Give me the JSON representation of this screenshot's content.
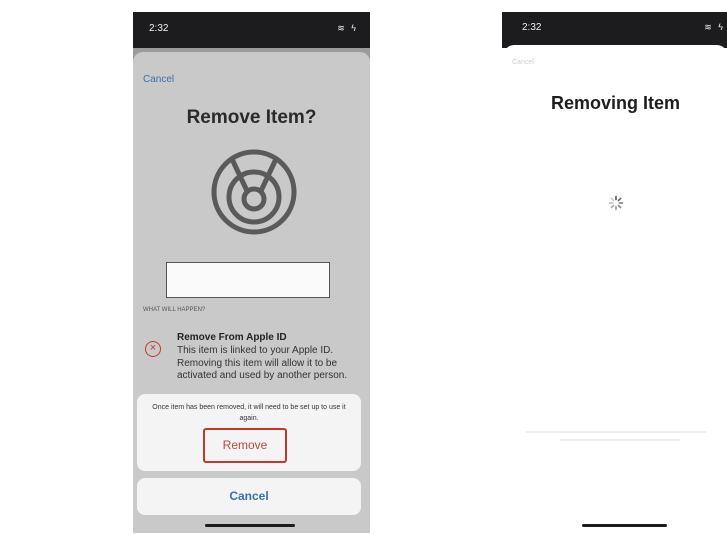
{
  "left_screen": {
    "status": {
      "time": "2:32",
      "icons": "wifi-battery"
    },
    "cancel_link": "Cancel",
    "title": "Remove Item?",
    "section_header": "WHAT WILL HAPPEN?",
    "item": {
      "title": "Remove From Apple ID",
      "description": "This item is linked to your Apple ID. Removing this item will allow it to be activated and used by another person."
    },
    "action_note": "Once item has been removed, it will need to be set up to use it again.",
    "remove_button": "Remove",
    "cancel_button": "Cancel",
    "colors": {
      "accent_blue": "#3a6fb0",
      "destructive_red": "#c0392b"
    }
  },
  "right_screen": {
    "status": {
      "time": "2:32",
      "icons": "wifi-battery"
    },
    "cancel_link": "Cancel",
    "title": "Removing Item"
  }
}
